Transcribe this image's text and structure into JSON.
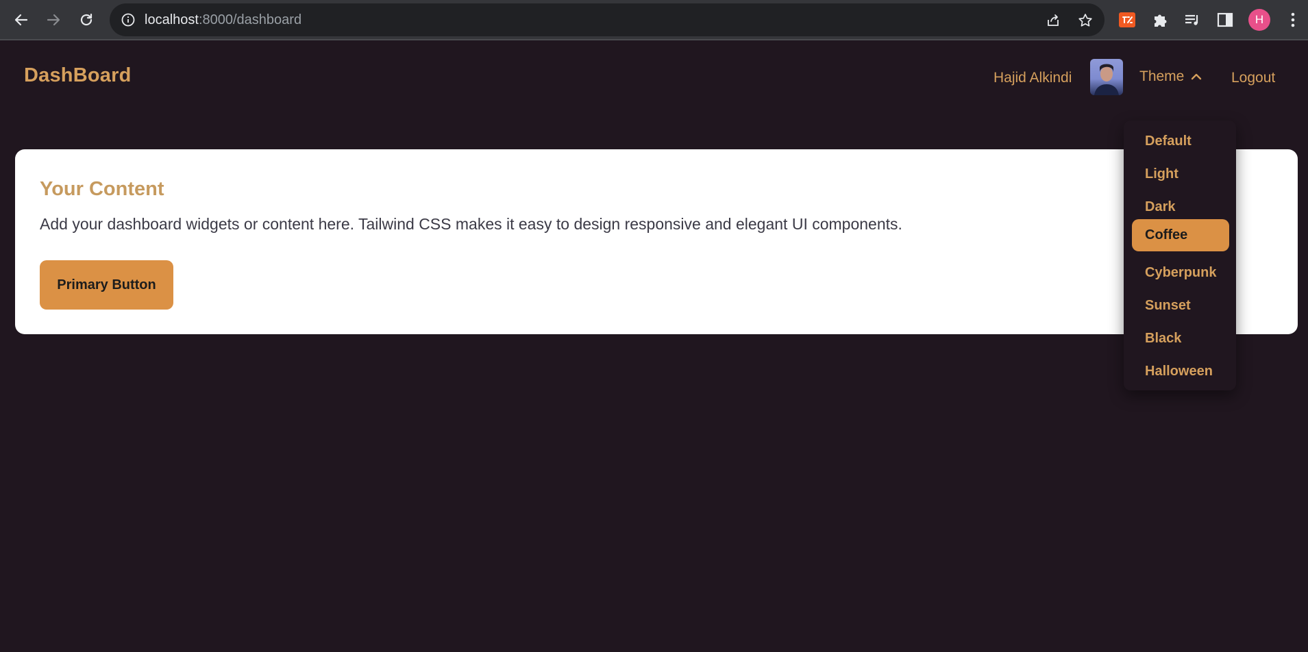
{
  "browser": {
    "url_host": "localhost",
    "url_path": ":8000/dashboard",
    "profile_initial": "H"
  },
  "navbar": {
    "brand": "DashBoard",
    "user_name": "Hajid Alkindi",
    "theme_label": "Theme",
    "logout_label": "Logout"
  },
  "content": {
    "title": "Your Content",
    "description": "Add your dashboard widgets or content here. Tailwind CSS makes it easy to design responsive and elegant UI components.",
    "button_label": "Primary Button"
  },
  "theme_menu": {
    "items": [
      {
        "label": "Default"
      },
      {
        "label": "Light"
      },
      {
        "label": "Dark"
      },
      {
        "label": "Coffee"
      },
      {
        "label": "Cyberpunk"
      },
      {
        "label": "Sunset"
      },
      {
        "label": "Black"
      },
      {
        "label": "Halloween"
      }
    ],
    "selected": "Coffee"
  },
  "colors": {
    "background": "#20161f",
    "accent": "#d6a05d",
    "button": "#db9145"
  },
  "icons": {
    "back": "back-arrow-icon",
    "forward": "forward-arrow-icon",
    "reload": "reload-icon",
    "info": "info-icon",
    "share": "share-icon",
    "bookmark": "star-icon",
    "extensions": "puzzle-icon",
    "media": "media-queue-icon",
    "sidepanel": "side-panel-icon",
    "menu": "kebab-menu-icon",
    "theme_caret": "chevron-up-icon"
  }
}
